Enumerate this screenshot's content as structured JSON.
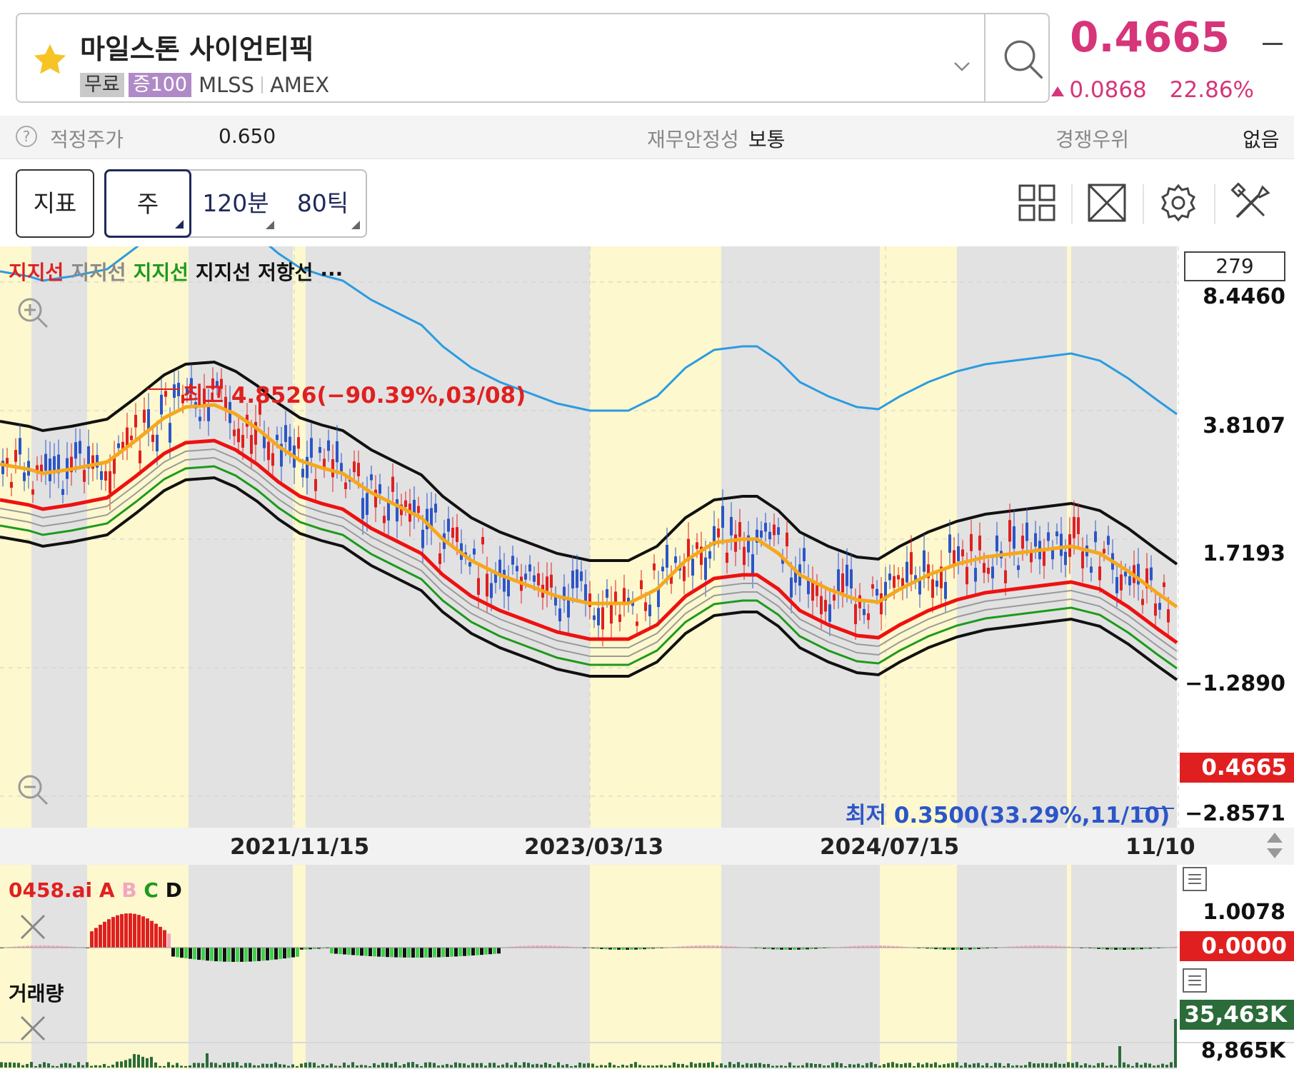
{
  "header": {
    "stock_name": "마일스톤 사이언티픽",
    "tag_free": "무료",
    "tag_margin": "증100",
    "ticker": "MLSS",
    "exchange": "AMEX",
    "icons": [
      "star-icon",
      "chevron-down-icon",
      "search-icon"
    ]
  },
  "quote": {
    "price": "0.4665",
    "change": "0.0868",
    "change_pct": "22.86%",
    "up_color": "#d6357a"
  },
  "info_bar": {
    "fair_price_label": "적정주가",
    "fair_price_value": "0.650",
    "stability_label": "재무안정성",
    "stability_value": "보통",
    "advantage_label": "경쟁우위",
    "advantage_value": "없음"
  },
  "toolbar": {
    "indicator_label": "지표",
    "periods": [
      "주",
      "120분",
      "80틱"
    ],
    "active_period": "주",
    "tools": [
      "grid-layout-icon",
      "fullscreen-icon",
      "settings-gear-icon",
      "tools-icon"
    ]
  },
  "chart": {
    "legend": [
      {
        "text": "지지선",
        "color": "#e02020"
      },
      {
        "text": "지지선",
        "color": "#8a8a8a"
      },
      {
        "text": "지지선",
        "color": "#1d9a1d"
      },
      {
        "text": "지지선",
        "color": "#111111"
      },
      {
        "text": "저항선",
        "color": "#111111"
      },
      {
        "text": "...",
        "color": "#111111"
      }
    ],
    "count_badge": "279",
    "y_ticks": [
      "8.4460",
      "3.8107",
      "1.7193",
      "−1.2890",
      "−2.8571"
    ],
    "current_tag": "0.4665",
    "high_annotation": "최고 4.8526(−90.39%,03/08)",
    "low_annotation": "최저 0.3500(33.29%,11/10)",
    "date_labels": [
      "2021/11/15",
      "2023/03/13",
      "2024/07/15",
      "11/10"
    ],
    "colors": {
      "red": "#ee1111",
      "orange": "#f5a81c",
      "blue": "#2b9be0",
      "black": "#111111",
      "green": "#1d9a1d",
      "yellow_bg": "#fdf8cd",
      "grey_bg": "#e2e2e2",
      "up_candle": "#e02020",
      "down_candle": "#2b55c8"
    }
  },
  "chart_data": {
    "type": "line",
    "x_axis_labels": [
      "2021/11/15",
      "2023/03/13",
      "2024/07/15",
      "11/10"
    ],
    "y_ticks": [
      "8.4460",
      "3.8107",
      "1.7193",
      "−1.2890",
      "−2.8571"
    ],
    "current_price": 0.4665,
    "high": {
      "value": 4.8526,
      "pct": "−90.39%",
      "date": "03/08"
    },
    "low": {
      "value": 0.35,
      "pct": "33.29%",
      "date": "11/10"
    },
    "series_labels": [
      "지지선",
      "지지선",
      "지지선",
      "지지선",
      "저항선"
    ]
  },
  "oscillator": {
    "title": "0458.ai",
    "legend_a": "A",
    "legend_b": "B",
    "legend_c": "C",
    "legend_d": "D",
    "max_label": "1.0078",
    "zero_tag": "0.0000"
  },
  "volume": {
    "title": "거래량",
    "current_tag": "35,463K",
    "scale_label": "8,865K"
  }
}
